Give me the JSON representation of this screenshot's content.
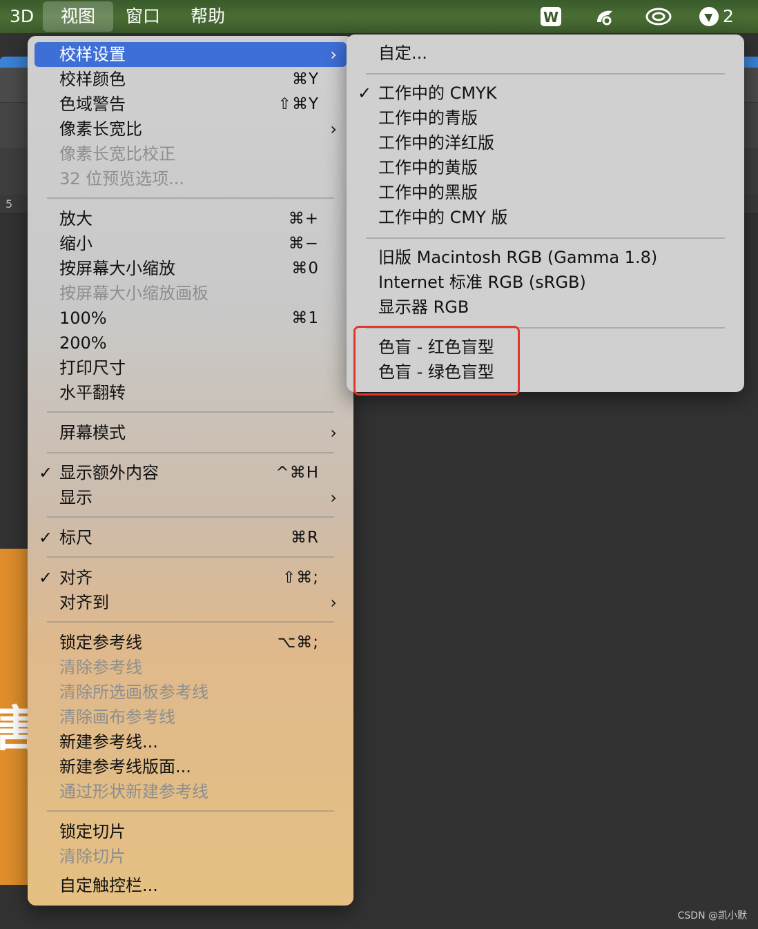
{
  "menubar": {
    "items": [
      "3D",
      "视图",
      "窗口",
      "帮助"
    ],
    "active_index": 1,
    "tray": {
      "icons": [
        "wps-icon",
        "pen-app-icon",
        "creative-cloud-icon",
        "notification-bird-icon"
      ],
      "badge": "2"
    }
  },
  "canvas": {
    "ruler_label": "5"
  },
  "view_menu": {
    "items": [
      {
        "label": "校样设置",
        "shortcut": "",
        "submenu": true,
        "checked": false,
        "disabled": false,
        "highlighted": true
      },
      {
        "label": "校样颜色",
        "shortcut": "⌘Y",
        "submenu": false,
        "checked": false,
        "disabled": false
      },
      {
        "label": "色域警告",
        "shortcut": "⇧⌘Y",
        "submenu": false,
        "checked": false,
        "disabled": false
      },
      {
        "label": "像素长宽比",
        "shortcut": "",
        "submenu": true,
        "checked": false,
        "disabled": false
      },
      {
        "label": "像素长宽比校正",
        "shortcut": "",
        "submenu": false,
        "checked": false,
        "disabled": true
      },
      {
        "label": "32 位预览选项...",
        "shortcut": "",
        "submenu": false,
        "checked": false,
        "disabled": true
      },
      {
        "label": "放大",
        "shortcut": "⌘+",
        "submenu": false,
        "checked": false,
        "disabled": false
      },
      {
        "label": "缩小",
        "shortcut": "⌘−",
        "submenu": false,
        "checked": false,
        "disabled": false
      },
      {
        "label": "按屏幕大小缩放",
        "shortcut": "⌘0",
        "submenu": false,
        "checked": false,
        "disabled": false
      },
      {
        "label": "按屏幕大小缩放画板",
        "shortcut": "",
        "submenu": false,
        "checked": false,
        "disabled": true
      },
      {
        "label": "100%",
        "shortcut": "⌘1",
        "submenu": false,
        "checked": false,
        "disabled": false
      },
      {
        "label": "200%",
        "shortcut": "",
        "submenu": false,
        "checked": false,
        "disabled": false
      },
      {
        "label": "打印尺寸",
        "shortcut": "",
        "submenu": false,
        "checked": false,
        "disabled": false
      },
      {
        "label": "水平翻转",
        "shortcut": "",
        "submenu": false,
        "checked": false,
        "disabled": false
      },
      {
        "label": "屏幕模式",
        "shortcut": "",
        "submenu": true,
        "checked": false,
        "disabled": false
      },
      {
        "label": "显示额外内容",
        "shortcut": "^⌘H",
        "submenu": false,
        "checked": true,
        "disabled": false
      },
      {
        "label": "显示",
        "shortcut": "",
        "submenu": true,
        "checked": false,
        "disabled": false
      },
      {
        "label": "标尺",
        "shortcut": "⌘R",
        "submenu": false,
        "checked": true,
        "disabled": false
      },
      {
        "label": "对齐",
        "shortcut": "⇧⌘;",
        "submenu": false,
        "checked": true,
        "disabled": false
      },
      {
        "label": "对齐到",
        "shortcut": "",
        "submenu": true,
        "checked": false,
        "disabled": false
      },
      {
        "label": "锁定参考线",
        "shortcut": "⌥⌘;",
        "submenu": false,
        "checked": false,
        "disabled": false
      },
      {
        "label": "清除参考线",
        "shortcut": "",
        "submenu": false,
        "checked": false,
        "disabled": true
      },
      {
        "label": "清除所选画板参考线",
        "shortcut": "",
        "submenu": false,
        "checked": false,
        "disabled": true
      },
      {
        "label": "清除画布参考线",
        "shortcut": "",
        "submenu": false,
        "checked": false,
        "disabled": true
      },
      {
        "label": "新建参考线...",
        "shortcut": "",
        "submenu": false,
        "checked": false,
        "disabled": false
      },
      {
        "label": "新建参考线版面...",
        "shortcut": "",
        "submenu": false,
        "checked": false,
        "disabled": false
      },
      {
        "label": "通过形状新建参考线",
        "shortcut": "",
        "submenu": false,
        "checked": false,
        "disabled": true
      },
      {
        "label": "锁定切片",
        "shortcut": "",
        "submenu": false,
        "checked": false,
        "disabled": false
      },
      {
        "label": "清除切片",
        "shortcut": "",
        "submenu": false,
        "checked": false,
        "disabled": true
      },
      {
        "label": "自定触控栏...",
        "shortcut": "",
        "submenu": false,
        "checked": false,
        "disabled": false
      }
    ]
  },
  "proof_submenu": {
    "items": [
      {
        "label": "自定...",
        "checked": false
      },
      {
        "label": "工作中的 CMYK",
        "checked": true
      },
      {
        "label": "工作中的青版",
        "checked": false
      },
      {
        "label": "工作中的洋红版",
        "checked": false
      },
      {
        "label": "工作中的黄版",
        "checked": false
      },
      {
        "label": "工作中的黑版",
        "checked": false
      },
      {
        "label": "工作中的 CMY 版",
        "checked": false
      },
      {
        "label": "旧版 Macintosh RGB (Gamma 1.8)",
        "checked": false
      },
      {
        "label": "Internet 标准 RGB (sRGB)",
        "checked": false
      },
      {
        "label": "显示器 RGB",
        "checked": false
      },
      {
        "label": "色盲 - 红色盲型",
        "checked": false
      },
      {
        "label": "色盲 - 绿色盲型",
        "checked": false
      }
    ],
    "highlight_color": "#e0392b"
  },
  "watermark": "CSDN @凯小默"
}
